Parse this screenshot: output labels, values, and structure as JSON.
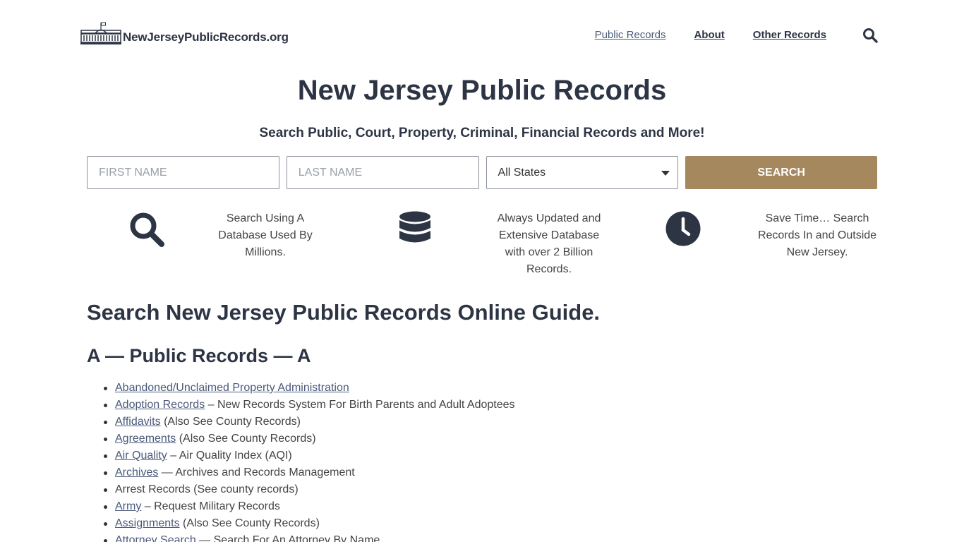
{
  "header": {
    "logo_text": "NewJerseyPublicRecords.org",
    "nav": [
      {
        "label": "Public Records"
      },
      {
        "label": "About"
      },
      {
        "label": "Other Records"
      }
    ]
  },
  "hero": {
    "title": "New Jersey Public Records",
    "subtitle": "Search Public, Court, Property, Criminal, Financial Records and More!"
  },
  "search_form": {
    "first_name_placeholder": "FIRST NAME",
    "last_name_placeholder": "LAST NAME",
    "state_selected": "All States",
    "button_label": "SEARCH"
  },
  "features": [
    {
      "icon": "magnifier-icon",
      "text": "Search Using A Database Used By Millions."
    },
    {
      "icon": "database-icon",
      "text": "Always Updated and Extensive Database with over 2 Billion Records."
    },
    {
      "icon": "clock-icon",
      "text": "Save Time… Search Records In and Outside New Jersey."
    }
  ],
  "guide": {
    "title": "Search New Jersey Public Records Online Guide.",
    "section_title": "A — Public Records — A"
  },
  "records": [
    {
      "link": "Abandoned/Unclaimed Property Administration",
      "suffix": ""
    },
    {
      "link": "Adoption Records",
      "suffix": " – New Records System For Birth Parents and Adult Adoptees"
    },
    {
      "link": "Affidavits",
      "suffix": " (Also See County Records)"
    },
    {
      "link": "Agreements",
      "suffix": " (Also See County Records)"
    },
    {
      "link": "Air Quality",
      "suffix": " – Air Quality Index (AQI)"
    },
    {
      "link": "Archives",
      "suffix": " — Archives and Records Management"
    },
    {
      "link": "",
      "suffix": "Arrest Records (See county records)"
    },
    {
      "link": "Army",
      "suffix": " – Request Military Records"
    },
    {
      "link": "Assignments",
      "suffix": " (Also See County Records)"
    },
    {
      "link": "Attorney Search",
      "suffix": " — Search For An Attorney By Name"
    }
  ],
  "colors": {
    "brand_dark": "#2d3444",
    "accent_gold": "#a6885f",
    "link": "#4a5a7a"
  }
}
